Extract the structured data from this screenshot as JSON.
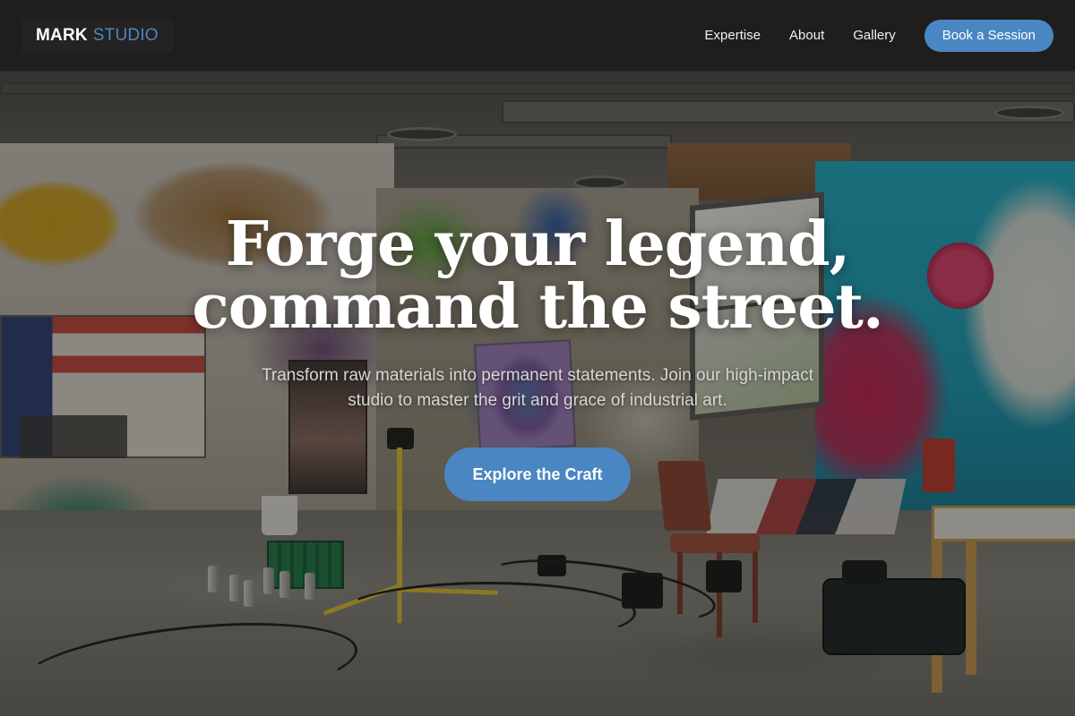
{
  "nav": {
    "brand_primary": "MARK",
    "brand_accent": "STUDIO",
    "links": [
      "Expertise",
      "About",
      "Gallery"
    ],
    "cta_label": "Book a Session"
  },
  "hero": {
    "headline_line1": "Forge your legend,",
    "headline_line2": "command the street.",
    "subtext": "Transform raw materials into permanent statements. Join our high-impact studio to master the grit and grace of industrial art.",
    "button_label": "Explore the Craft"
  },
  "colors": {
    "accent": "#4a86c2",
    "navbar_bg": "#1f1e1d",
    "text": "#ffffff"
  }
}
